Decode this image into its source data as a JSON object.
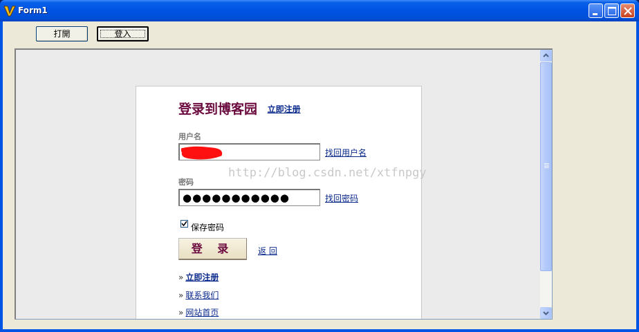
{
  "window": {
    "title": "Form1",
    "controls": [
      "minimize-icon",
      "maximize-icon",
      "close-icon"
    ]
  },
  "toolbar": {
    "open_label": "打開",
    "login_label": "登入"
  },
  "page": {
    "title": "登录到博客园",
    "register_link": "立即注册",
    "username_label": "用户名",
    "find_username_link": "找回用户名",
    "password_label": "密码",
    "password_value": "●●●●●●●●●●●",
    "find_password_link": "找回密码",
    "remember_label": "保存密码",
    "remember_checked": true,
    "login_button": "登 录",
    "back_link": "返 回",
    "links": [
      "立即注册",
      "联系我们",
      "网站首页"
    ],
    "link_arrow": "»"
  },
  "watermark": "http://blog.csdn.net/xtfnpgy",
  "colors": {
    "title_accent": "#6b0a3e",
    "link": "#0a2a8c",
    "titlebar": "#0054e3"
  }
}
